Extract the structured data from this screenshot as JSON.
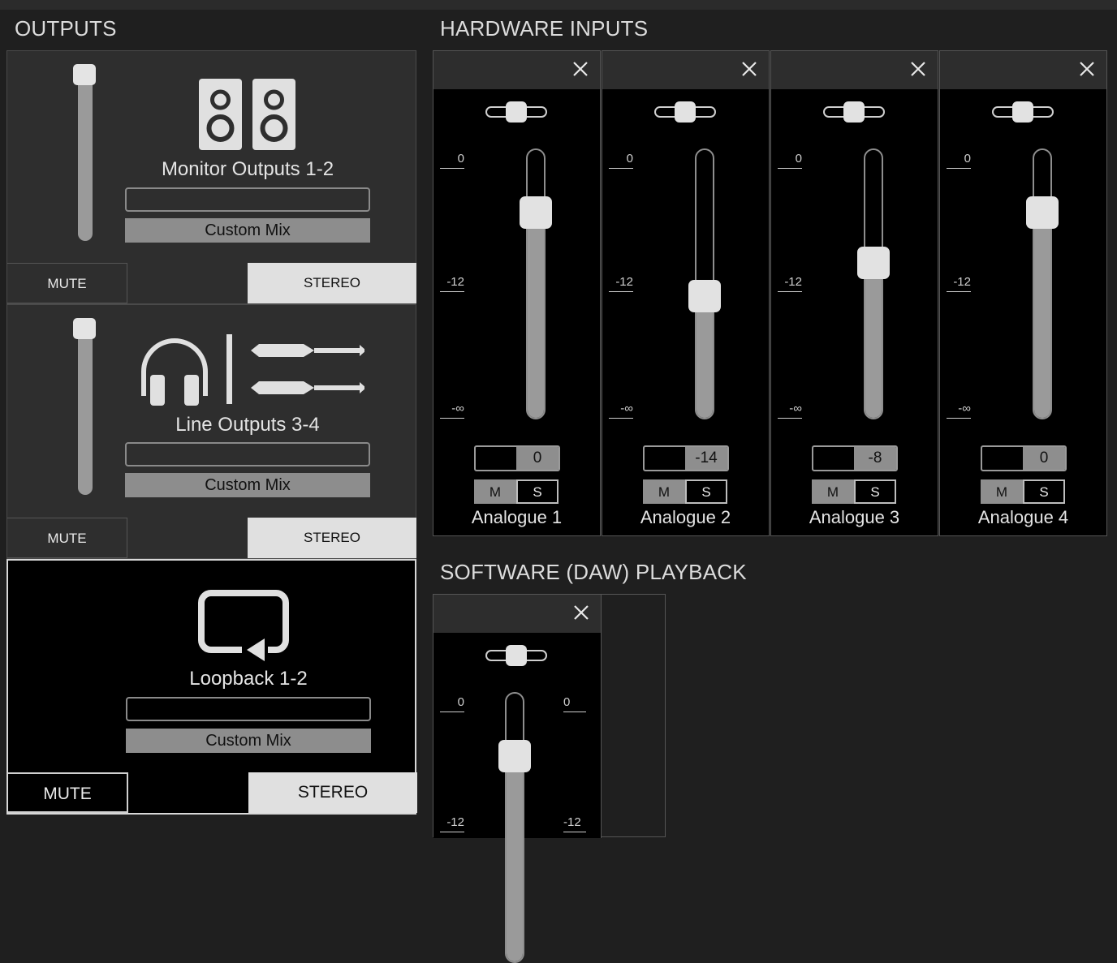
{
  "outputs": {
    "title": "OUTPUTS",
    "panels": [
      {
        "name": "Monitor Outputs 1-2",
        "mix": "Custom Mix",
        "mute": "MUTE",
        "stereo": "STEREO",
        "icon": "speakers-icon",
        "fader_level": 0.95
      },
      {
        "name": "Line Outputs 3-4",
        "mix": "Custom Mix",
        "mute": "MUTE",
        "stereo": "STEREO",
        "icon": "headphones-line-icon",
        "fader_level": 0.95
      },
      {
        "name": "Loopback 1-2",
        "mix": "Custom Mix",
        "mute": "MUTE",
        "stereo": "STEREO",
        "icon": "loopback-icon",
        "selected": true
      }
    ]
  },
  "hardware_inputs": {
    "title": "HARDWARE INPUTS",
    "scale": {
      "top": "0",
      "mid": "-12",
      "bottom": "-∞"
    },
    "channels": [
      {
        "name": "Analogue 1",
        "gain": "0",
        "fader_level": 0.8,
        "mute": "M",
        "solo": "S"
      },
      {
        "name": "Analogue 2",
        "gain": "-14",
        "fader_level": 0.45,
        "mute": "M",
        "solo": "S"
      },
      {
        "name": "Analogue 3",
        "gain": "-8",
        "fader_level": 0.59,
        "mute": "M",
        "solo": "S"
      },
      {
        "name": "Analogue 4",
        "gain": "0",
        "fader_level": 0.8,
        "mute": "M",
        "solo": "S"
      }
    ]
  },
  "software_playback": {
    "title": "SOFTWARE (DAW) PLAYBACK",
    "scale": {
      "top": "0",
      "top_right": "0",
      "mid": "-12",
      "mid_right": "-12"
    },
    "channels": [
      {
        "fader_level": 0.8
      }
    ]
  },
  "colors": {
    "background": "#1f1f1f",
    "panel": "#2e2e2e",
    "strip": "#000000",
    "accent_light": "#e0e0e0",
    "fill_gray": "#9a9a9a"
  }
}
